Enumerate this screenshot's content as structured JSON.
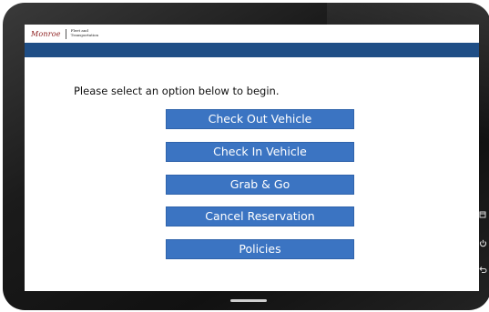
{
  "header": {
    "logo_text": "Monroe",
    "department": "Fleet and Transportation"
  },
  "main": {
    "prompt": "Please select an option below to begin.",
    "options": [
      {
        "label": "Check Out Vehicle"
      },
      {
        "label": "Check In Vehicle"
      },
      {
        "label": "Grab & Go"
      },
      {
        "label": "Cancel Reservation"
      },
      {
        "label": "Policies"
      }
    ]
  },
  "colors": {
    "header_bar": "#1f4e86",
    "button": "#3b74c2",
    "logo": "#8b1a1a"
  },
  "device": {
    "side_icons": [
      "recent-apps-icon",
      "power-icon",
      "back-icon"
    ]
  }
}
